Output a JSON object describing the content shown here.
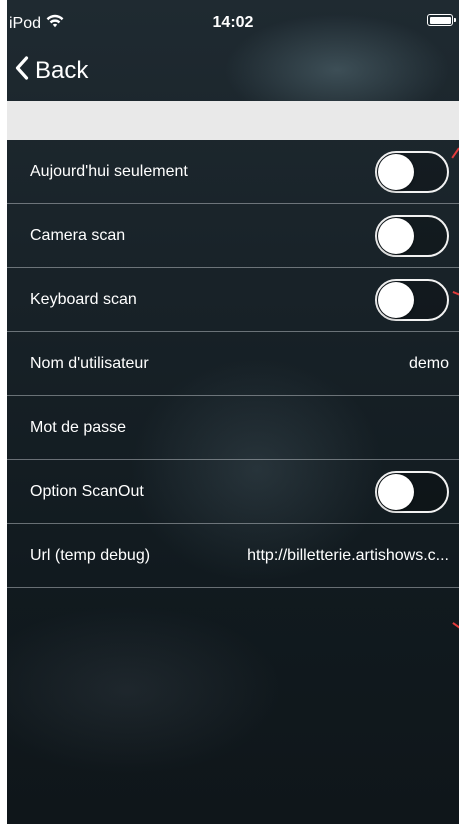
{
  "status_bar": {
    "carrier": "iPod",
    "time": "14:02",
    "icons": [
      "wifi-icon",
      "battery-icon"
    ]
  },
  "nav": {
    "back_label": "Back",
    "back_icon": "chevron-left-icon"
  },
  "settings": [
    {
      "label": "Aujourd'hui seulement",
      "type": "toggle",
      "on": false
    },
    {
      "label": "Camera scan",
      "type": "toggle",
      "on": false
    },
    {
      "label": "Keyboard scan",
      "type": "toggle",
      "on": false
    },
    {
      "label": "Nom d'utilisateur",
      "type": "value",
      "value": "demo"
    },
    {
      "label": "Mot de passe",
      "type": "value",
      "value": ""
    },
    {
      "label": "Option ScanOut",
      "type": "toggle",
      "on": false
    },
    {
      "label": "Url (temp debug)",
      "type": "value",
      "value": "http://billetterie.artishows.c..."
    }
  ],
  "colors": {
    "background": "#18222a",
    "header_band": "#e9e9e9",
    "text": "#ffffff",
    "separator": "#d2d7dc",
    "annotation": "#e23b3b"
  }
}
